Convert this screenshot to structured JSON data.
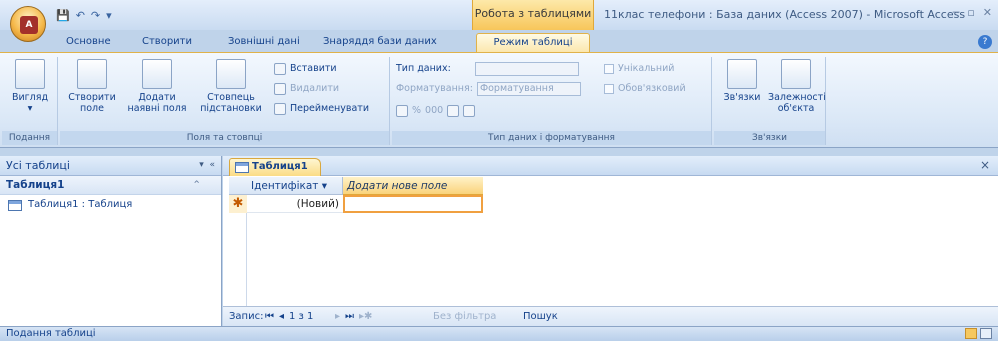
{
  "titlebar": {
    "contextual_group": "Робота з таблицями",
    "title": "11клас телефони : База даних (Access 2007) - Microsoft Access",
    "office_logo": "A"
  },
  "tabs": [
    "Основне",
    "Створити",
    "Зовнішні дані",
    "Знаряддя бази даних",
    "Режим таблиці"
  ],
  "ribbon": {
    "views": {
      "btn": "Вигляд",
      "label": "Подання"
    },
    "fields": {
      "new_field": "Створити поле",
      "add_existing": "Додати наявні поля",
      "lookup_col": "Стовпець підстановки",
      "insert": "Вставити",
      "delete": "Видалити",
      "rename": "Перейменувати",
      "label": "Поля та стовпці"
    },
    "datatype": {
      "type_label": "Тип даних:",
      "format_label": "Форматування:",
      "format_value": "Форматування",
      "unique": "Унікальний",
      "required": "Обов'язковий",
      "label": "Тип даних і форматування"
    },
    "relations": {
      "rel": "Зв'язки",
      "deps": "Залежності об'єкта",
      "label": "Зв'язки"
    }
  },
  "nav": {
    "header": "Усі таблиці",
    "group": "Таблиця1",
    "item": "Таблиця1 : Таблиця"
  },
  "doc": {
    "tab": "Таблиця1",
    "col_id": "Ідентифікат ▾",
    "col_add": "Додати нове поле",
    "new_cell": "(Новий)",
    "new_marker": "✱"
  },
  "recnav": {
    "label": "Запис:",
    "position": "1 з 1",
    "filter": "Без фільтра",
    "search": "Пошук"
  },
  "status": "Подання таблиці"
}
